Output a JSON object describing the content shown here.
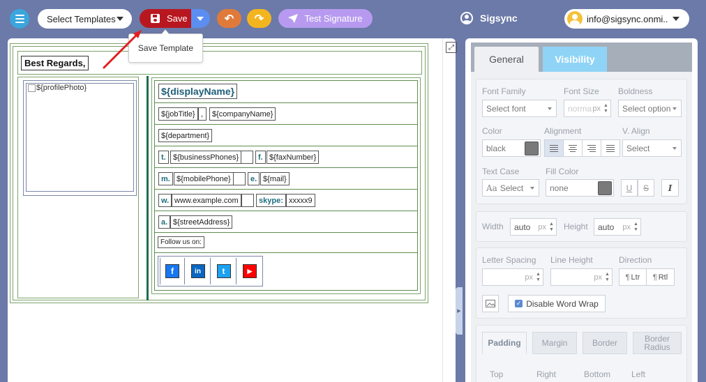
{
  "toolbar": {
    "select_templates": "Select Templates",
    "save": "Save",
    "test_signature": "Test Signature",
    "brand": "Sigsync",
    "account_email": "info@sigsync.onmi..",
    "save_tooltip": "Save Template"
  },
  "signature": {
    "greeting": "Best Regards,",
    "photo_alt": "${profilePhoto}",
    "display_name": "${displayName}",
    "job_title": "${jobTitle}",
    "separator": ",",
    "company_name": "${companyName}",
    "department": "${department}",
    "t_label": "t.",
    "business_phones": "${businessPhones}",
    "f_label": "f.",
    "fax_number": "${faxNumber}",
    "m_label": "m.",
    "mobile_phone": "${mobilePhone}",
    "e_label": "e.",
    "mail": "${mail}",
    "w_label": "w.",
    "website": "www.example.com",
    "skype_label": "skype:",
    "skype_value": "xxxxx9",
    "a_label": "a.",
    "street_address": "${streetAddress}",
    "follow_us": "Follow us on:",
    "social": [
      {
        "icon": "facebook-icon",
        "glyph": "f",
        "color": "#1877f2"
      },
      {
        "icon": "linkedin-icon",
        "glyph": "in",
        "color": "#0a66c2"
      },
      {
        "icon": "twitter-icon",
        "glyph": "t",
        "color": "#1da1f2"
      },
      {
        "icon": "youtube-icon",
        "glyph": "▶",
        "color": "#ff0000"
      }
    ]
  },
  "panel": {
    "tabs": {
      "general": "General",
      "visibility": "Visibility"
    },
    "font_family": {
      "label": "Font Family",
      "value": "Select font"
    },
    "font_size": {
      "label": "Font Size",
      "placeholder": "norma",
      "unit": "px"
    },
    "boldness": {
      "label": "Boldness",
      "value": "Select option"
    },
    "color": {
      "label": "Color",
      "value": "black"
    },
    "alignment": {
      "label": "Alignment"
    },
    "valign": {
      "label": "V. Align",
      "value": "Select"
    },
    "text_case": {
      "label": "Text Case",
      "value": "Select",
      "icon_text": "Aa"
    },
    "fill_color": {
      "label": "Fill Color",
      "value": "none"
    },
    "style_buttons": {
      "underline": "U",
      "strike": "S",
      "italic": "I"
    },
    "width": {
      "label": "Width",
      "value": "auto",
      "unit": "px"
    },
    "height": {
      "label": "Height",
      "value": "auto",
      "unit": "px"
    },
    "letter_spacing": {
      "label": "Letter Spacing",
      "unit": "px"
    },
    "line_height": {
      "label": "Line Height",
      "unit": "px"
    },
    "direction": {
      "label": "Direction",
      "ltr": "Ltr",
      "rtl": "Rtl"
    },
    "disable_word_wrap": "Disable Word Wrap",
    "subtabs": {
      "padding": "Padding",
      "margin": "Margin",
      "border": "Border",
      "border_radius": "Border Radius"
    },
    "sides": {
      "top": "Top",
      "right": "Right",
      "bottom": "Bottom",
      "left": "Left"
    }
  },
  "colors": {
    "save": "#b8171f",
    "undo": "#e07a3a",
    "redo": "#f3b51f",
    "test_signature": "#b79af0",
    "visibility_tab": "#8fd4f6",
    "divider": "#1e6e4e"
  }
}
